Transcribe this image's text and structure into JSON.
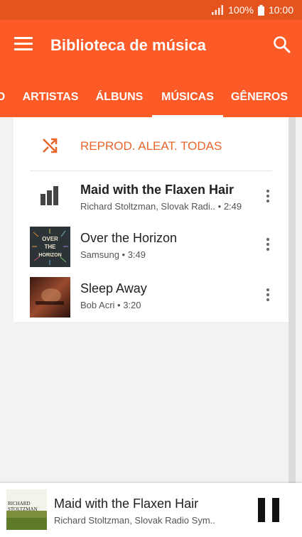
{
  "status_bar": {
    "battery": "100%",
    "time": "10:00",
    "icons": [
      "signal-icon",
      "battery-icon"
    ]
  },
  "header": {
    "title": "Biblioteca de música",
    "icons": [
      "menu-icon",
      "search-icon"
    ]
  },
  "tabs": [
    {
      "label": "O",
      "active": false
    },
    {
      "label": "ARTISTAS",
      "active": false
    },
    {
      "label": "ÁLBUNS",
      "active": false
    },
    {
      "label": "MÚSICAS",
      "active": true
    },
    {
      "label": "GÊNEROS",
      "active": false
    }
  ],
  "shuffle": {
    "label": "REPROD. ALEAT. TODAS",
    "icon": "shuffle-icon"
  },
  "songs": [
    {
      "title": "Maid with the Flaxen Hair",
      "subtitle": "Richard Stoltzman, Slovak Radi..",
      "duration": "• 2:49",
      "playing": true,
      "thumb_icon": "equalizer-icon"
    },
    {
      "title": "Over the Horizon",
      "subtitle": "Samsung • 3:49",
      "thumb_text": [
        "OVER",
        "THE",
        "HORIZON"
      ]
    },
    {
      "title": "Sleep Away",
      "subtitle": "Bob Acri • 3:20"
    }
  ],
  "now_playing": {
    "title": "Maid with the Flaxen Hair",
    "subtitle": "Richard Stoltzman, Slovak Radio Sym..",
    "art_text": [
      "RICHARD",
      "STOLTZMAN"
    ],
    "icon": "pause-icon"
  },
  "colors": {
    "status_bar": "#e4541e",
    "app_bar": "#fc5a26",
    "accent": "#e8652b",
    "background": "#f2f2f2"
  }
}
